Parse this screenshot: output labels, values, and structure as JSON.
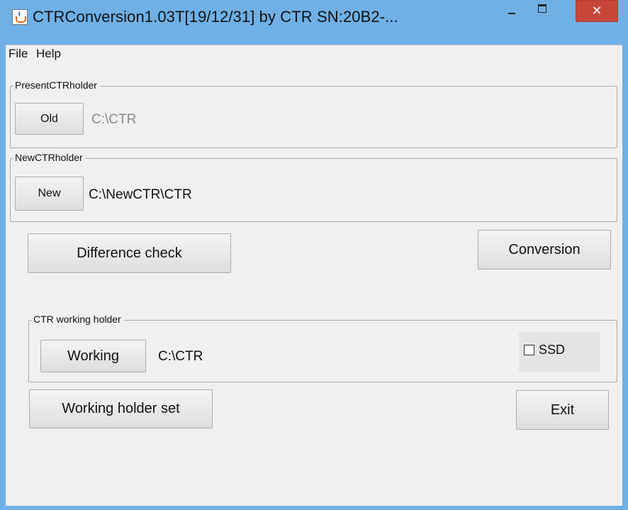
{
  "window": {
    "title": "CTRConversion1.03T[19/12/31] by CTR  SN:20B2-...",
    "minimize_label": "",
    "maximize_label": "",
    "close_label": "✕"
  },
  "menu": {
    "file": "File",
    "help": "Help"
  },
  "present_group": {
    "title": "PresentCTRholder",
    "button": "Old",
    "path": "C:\\CTR"
  },
  "new_group": {
    "title": "NewCTRholder",
    "button": "New",
    "path": "C:\\NewCTR\\CTR"
  },
  "actions": {
    "difference_check": "Difference check",
    "conversion": "Conversion"
  },
  "working_group": {
    "title": "CTR working holder",
    "button": "Working",
    "path": "C:\\CTR",
    "ssd_label": "SSD",
    "ssd_checked": false
  },
  "bottom": {
    "working_holder_set": "Working holder set",
    "exit": "Exit"
  }
}
